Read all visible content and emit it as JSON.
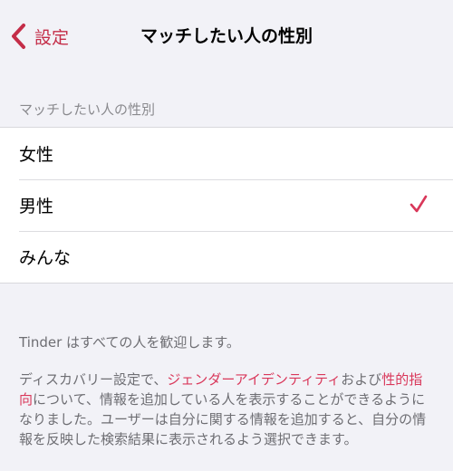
{
  "nav": {
    "back_label": "設定",
    "title": "マッチしたい人の性別"
  },
  "section": {
    "header": "マッチしたい人の性別"
  },
  "options": [
    {
      "label": "女性",
      "selected": false
    },
    {
      "label": "男性",
      "selected": true
    },
    {
      "label": "みんな",
      "selected": false
    }
  ],
  "footer": {
    "welcome": "Tinder はすべての人を歓迎します。",
    "desc_part1": "ディスカバリー設定で、",
    "link_gender_identity": "ジェンダーアイデンティティ",
    "desc_part2": "および",
    "link_sexual_orientation": "性的指向",
    "desc_part3": "について、情報を追加している人を表示することができるようになりました。ユーザーは自分に関する情報を追加すると、自分の情報を反映した検索結果に表示されるよう選択できます。"
  },
  "colors": {
    "accent": "#c42d48",
    "link": "#d9375a",
    "background": "#f2f2f7"
  },
  "icons": {
    "back": "chevron-left-icon",
    "selected": "checkmark-icon"
  }
}
